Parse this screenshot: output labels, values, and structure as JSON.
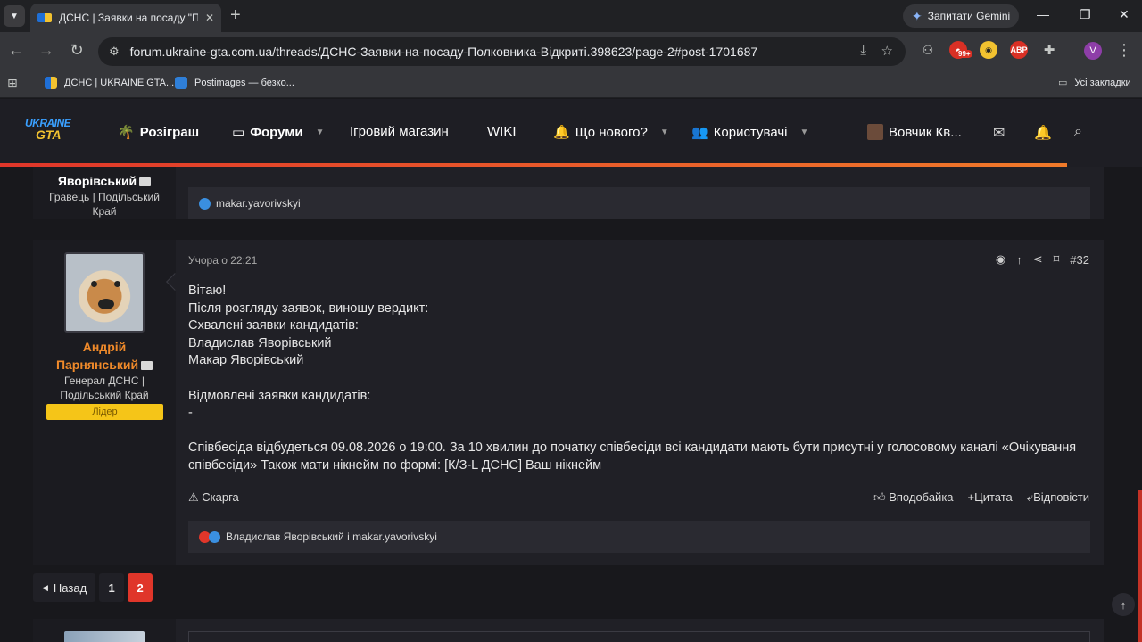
{
  "browser": {
    "tab_title": "ДСНС | Заявки на посаду \"Полкон",
    "gemini_label": "Запитати Gemini",
    "url": "forum.ukraine-gta.com.ua/threads/ДСНС-Заявки-на-посаду-Полковника-Відкриті.398623/page-2#post-1701687",
    "bookmarks": [
      "ДСНС | UKRAINE GTA...",
      "Postimages — безко..."
    ],
    "all_bookmarks": "Усі закладки",
    "badge": "99+",
    "abp": "ABP",
    "profile_letter": "V"
  },
  "header": {
    "logo_top": "UKRAINE",
    "logo_bottom": "GTA",
    "nav": {
      "giveaway": "Розіграш",
      "forums": "Форуми",
      "shop": "Ігровий магазин",
      "wiki": "WIKI",
      "whats_new": "Що нового?",
      "users": "Користувачі"
    },
    "username": "Вовчик Кв..."
  },
  "prev_post": {
    "name": "Яворівський",
    "title": "Гравець | Подільський Край",
    "reactions": "makar.yavorivskyi"
  },
  "post": {
    "author_first": "Андрій",
    "author_last": "Парнянський",
    "author_title": "Генерал ДСНС | Подільський Край",
    "badge": "Лідер",
    "time": "Учора о 22:21",
    "number": "#32",
    "lines": [
      "Вітаю!",
      "Після розгляду заявок, виношу вердикт:",
      "Схвалені заявки кандидатів:",
      "Владислав Яворівський",
      "Макар Яворівський",
      "",
      "Відмовлені заявки кандидатів:",
      "-",
      "",
      "Співбесіда відбудеться 09.08.2026 о 19:00. За 10 хвилин до початку співбесіди всі кандидати мають бути присутні у голосовому каналі «Очікування співбесіди» Також мати нікнейм по формі: [К/З-L ДСНС] Ваш нікнейм"
    ],
    "report": "Скарга",
    "like": "Вподобайка",
    "quote": "Цитата",
    "reply": "Відповісти",
    "reactions": "Владислав Яворівський і makar.yavorivskyi"
  },
  "pagination": {
    "back": "Назад",
    "pages": [
      "1",
      "2"
    ],
    "current": "2"
  }
}
